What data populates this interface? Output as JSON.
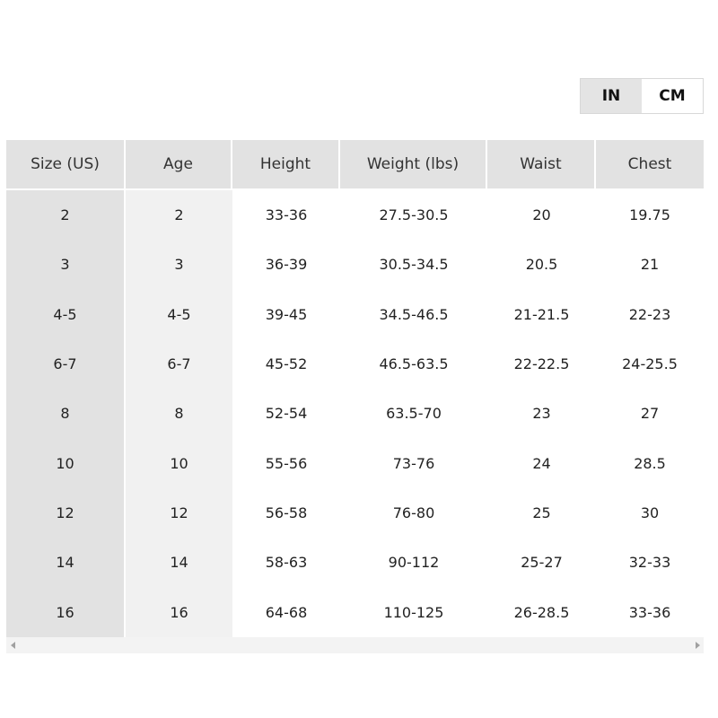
{
  "unit_toggle": {
    "options": [
      "IN",
      "CM"
    ],
    "selected": "IN"
  },
  "size_table": {
    "headers": [
      "Size (US)",
      "Age",
      "Height",
      "Weight (lbs)",
      "Waist",
      "Chest"
    ],
    "rows": [
      [
        "2",
        "2",
        "33-36",
        "27.5-30.5",
        "20",
        "19.75"
      ],
      [
        "3",
        "3",
        "36-39",
        "30.5-34.5",
        "20.5",
        "21"
      ],
      [
        "4-5",
        "4-5",
        "39-45",
        "34.5-46.5",
        "21-21.5",
        "22-23"
      ],
      [
        "6-7",
        "6-7",
        "45-52",
        "46.5-63.5",
        "22-22.5",
        "24-25.5"
      ],
      [
        "8",
        "8",
        "52-54",
        "63.5-70",
        "23",
        "27"
      ],
      [
        "10",
        "10",
        "55-56",
        "73-76",
        "24",
        "28.5"
      ],
      [
        "12",
        "12",
        "56-58",
        "76-80",
        "25",
        "30"
      ],
      [
        "14",
        "14",
        "58-63",
        "90-112",
        "25-27",
        "32-33"
      ],
      [
        "16",
        "16",
        "64-68",
        "110-125",
        "26-28.5",
        "33-36"
      ]
    ]
  },
  "scrollbar": {
    "left_icon": "triangle-left-icon",
    "right_icon": "triangle-right-icon"
  }
}
